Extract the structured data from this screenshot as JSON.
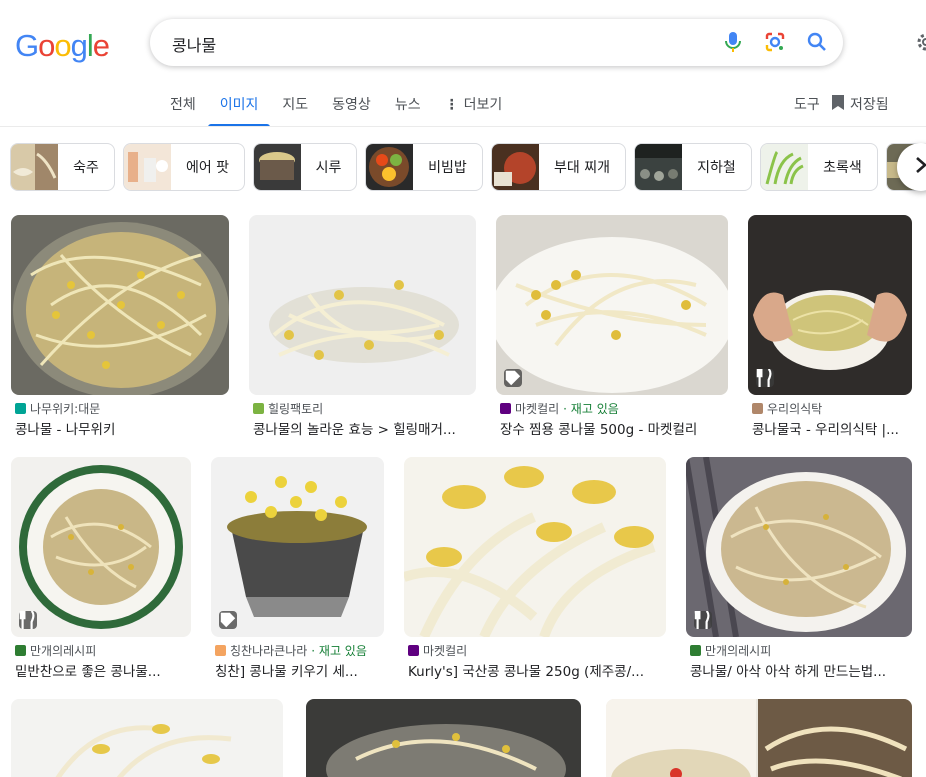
{
  "logo": {
    "letters": [
      "G",
      "o",
      "o",
      "g",
      "l",
      "e"
    ],
    "colors": [
      "#4285f4",
      "#ea4335",
      "#fbbc05",
      "#4285f4",
      "#34a853",
      "#ea4335"
    ]
  },
  "search": {
    "query": "콩나물",
    "icons": [
      "mic-icon",
      "lens-icon",
      "search-icon"
    ]
  },
  "tabs": [
    {
      "label": "전체",
      "active": false
    },
    {
      "label": "이미지",
      "active": true
    },
    {
      "label": "지도",
      "active": false
    },
    {
      "label": "동영상",
      "active": false
    },
    {
      "label": "뉴스",
      "active": false
    },
    {
      "label": "더보기",
      "active": false
    }
  ],
  "tools_label": "도구",
  "saved_label": "저장됨",
  "chips": [
    {
      "label": "숙주"
    },
    {
      "label": "에어 팟"
    },
    {
      "label": "시루"
    },
    {
      "label": "비빔밥"
    },
    {
      "label": "부대 찌개"
    },
    {
      "label": "지하철"
    },
    {
      "label": "초록색"
    }
  ],
  "results": [
    {
      "source": "나무위키:대문",
      "stock": "",
      "title": "콩나물 - 나무위키",
      "favicon_color": "#00a495"
    },
    {
      "source": "힐링팩토리",
      "stock": "",
      "title": "콩나물의 놀라운 효능 > 힐링매거...",
      "favicon_color": "#7cb342"
    },
    {
      "source": "마켓컬리",
      "stock": "· 재고 있음",
      "title": "장수 찜용 콩나물 500g - 마켓컬리",
      "favicon_color": "#5f0080"
    },
    {
      "source": "우리의식탁",
      "stock": "",
      "title": "콩나물국 - 우리의식탁 |...",
      "favicon_color": "#b0876a"
    },
    {
      "source": "만개의레시피",
      "stock": "",
      "title": "밑반찬으로 좋은 콩나물...",
      "favicon_color": "#2e7d32"
    },
    {
      "source": "칭찬나라큰나라",
      "stock": "· 재고 있음",
      "title": "칭찬] 콩나물 키우기 세...",
      "favicon_color": "#f4a460"
    },
    {
      "source": "마켓컬리",
      "stock": "",
      "title": "Kurly's] 국산콩 콩나물 250g (제주콩/...",
      "favicon_color": "#5f0080"
    },
    {
      "source": "만개의레시피",
      "stock": "",
      "title": "콩나물/ 아삭 아삭 하게 만드는법...",
      "favicon_color": "#2e7d32"
    }
  ]
}
